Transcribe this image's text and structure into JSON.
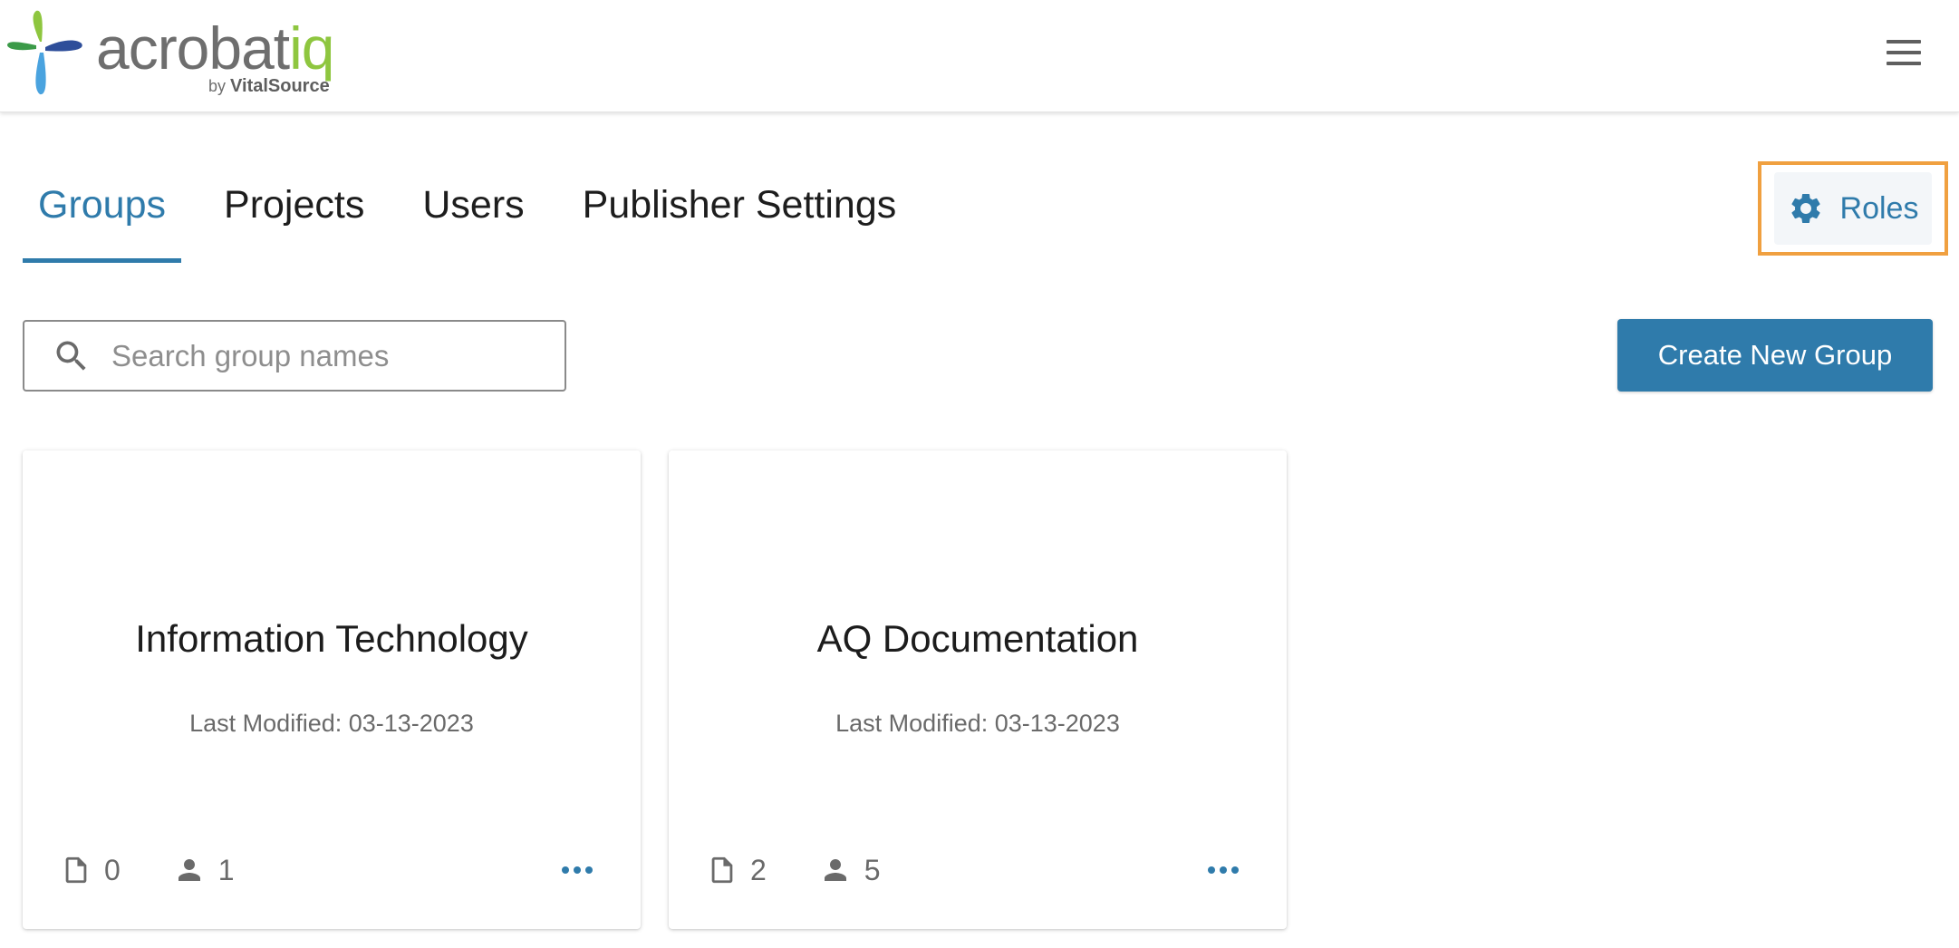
{
  "header": {
    "logo_text_main": "acrobat",
    "logo_text_accent": "iq",
    "logo_by": "by",
    "logo_vendor": "VitalSource",
    "menu_icon": "hamburger-menu-icon"
  },
  "tabs": [
    {
      "label": "Groups",
      "active": true
    },
    {
      "label": "Projects",
      "active": false
    },
    {
      "label": "Users",
      "active": false
    },
    {
      "label": "Publisher Settings",
      "active": false
    }
  ],
  "roles_button": {
    "label": "Roles",
    "icon": "gear-icon"
  },
  "search": {
    "placeholder": "Search group names",
    "value": "",
    "icon": "search-icon"
  },
  "create_button": {
    "label": "Create New Group"
  },
  "groups": [
    {
      "name": "Information Technology",
      "last_modified": "Last Modified: 03-13-2023",
      "projects": "0",
      "users": "1"
    },
    {
      "name": "AQ Documentation",
      "last_modified": "Last Modified: 03-13-2023",
      "projects": "2",
      "users": "5"
    }
  ],
  "colors": {
    "primary": "#2f7bab",
    "highlight": "#f0a040",
    "logo_accent": "#8ec63f"
  }
}
